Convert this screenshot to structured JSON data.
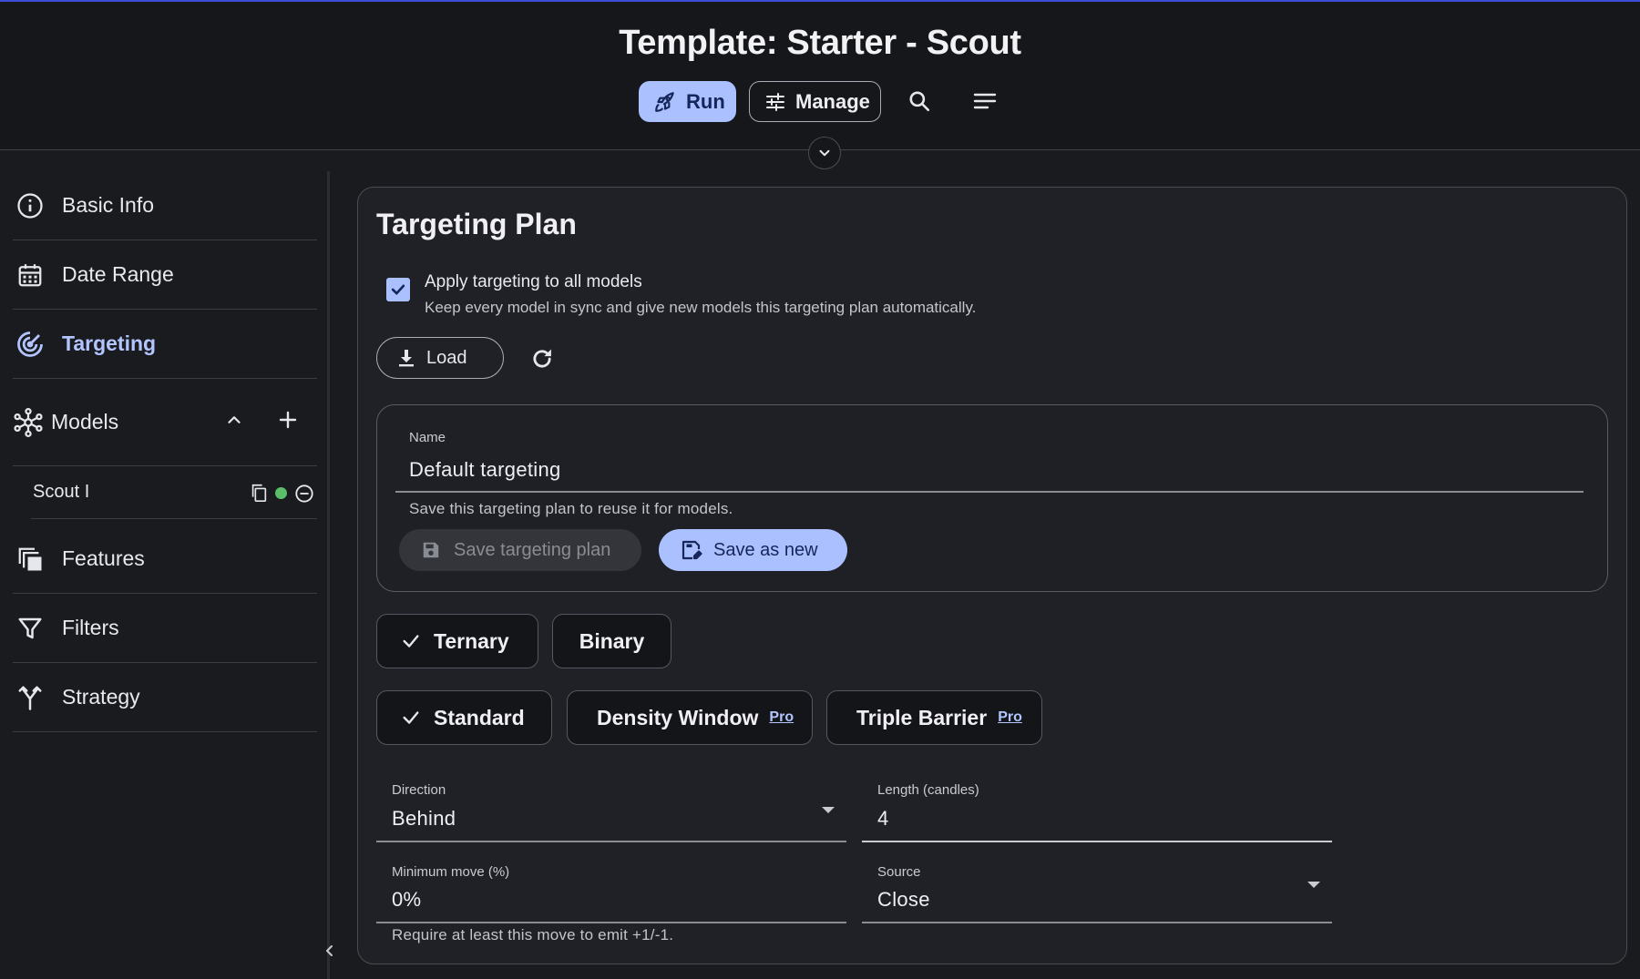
{
  "header": {
    "title": "Template: Starter - Scout",
    "run_label": "Run",
    "manage_label": "Manage"
  },
  "sidebar": {
    "items": [
      {
        "label": "Basic Info",
        "icon": "info-icon"
      },
      {
        "label": "Date Range",
        "icon": "calendar-icon"
      },
      {
        "label": "Targeting",
        "icon": "target-icon",
        "active": true
      },
      {
        "label": "Models",
        "icon": "network-icon"
      },
      {
        "label": "Features",
        "icon": "layers-icon"
      },
      {
        "label": "Filters",
        "icon": "filter-icon"
      },
      {
        "label": "Strategy",
        "icon": "fork-icon"
      }
    ],
    "model_item": {
      "label": "Scout I",
      "status_color": "#5bbf6a"
    }
  },
  "panel": {
    "title": "Targeting Plan",
    "apply_all": {
      "checked": true,
      "label": "Apply targeting to all models",
      "description": "Keep every model in sync and give new models this targeting plan automatically."
    },
    "load_label": "Load",
    "plan": {
      "name_label": "Name",
      "name_value": "Default targeting",
      "helper": "Save this targeting plan to reuse it for models.",
      "save_label": "Save targeting plan",
      "save_new_label": "Save as new"
    },
    "mode_chips": [
      {
        "label": "Ternary",
        "selected": true
      },
      {
        "label": "Binary",
        "selected": false
      }
    ],
    "method_chips": [
      {
        "label": "Standard",
        "selected": true
      },
      {
        "label": "Density Window",
        "badge": "Pro",
        "selected": false
      },
      {
        "label": "Triple Barrier",
        "badge": "Pro",
        "selected": false
      }
    ],
    "fields": {
      "direction": {
        "label": "Direction",
        "value": "Behind"
      },
      "length": {
        "label": "Length (candles)",
        "value": "4"
      },
      "min_move": {
        "label": "Minimum move (%)",
        "value": "0%",
        "helper": "Require at least this move to emit +1/-1."
      },
      "source": {
        "label": "Source",
        "value": "Close"
      }
    }
  },
  "colors": {
    "accent": "#abc0ff",
    "accent_text": "#17265a",
    "background": "#1a1b1f",
    "top_line": "#3f4ed6"
  }
}
